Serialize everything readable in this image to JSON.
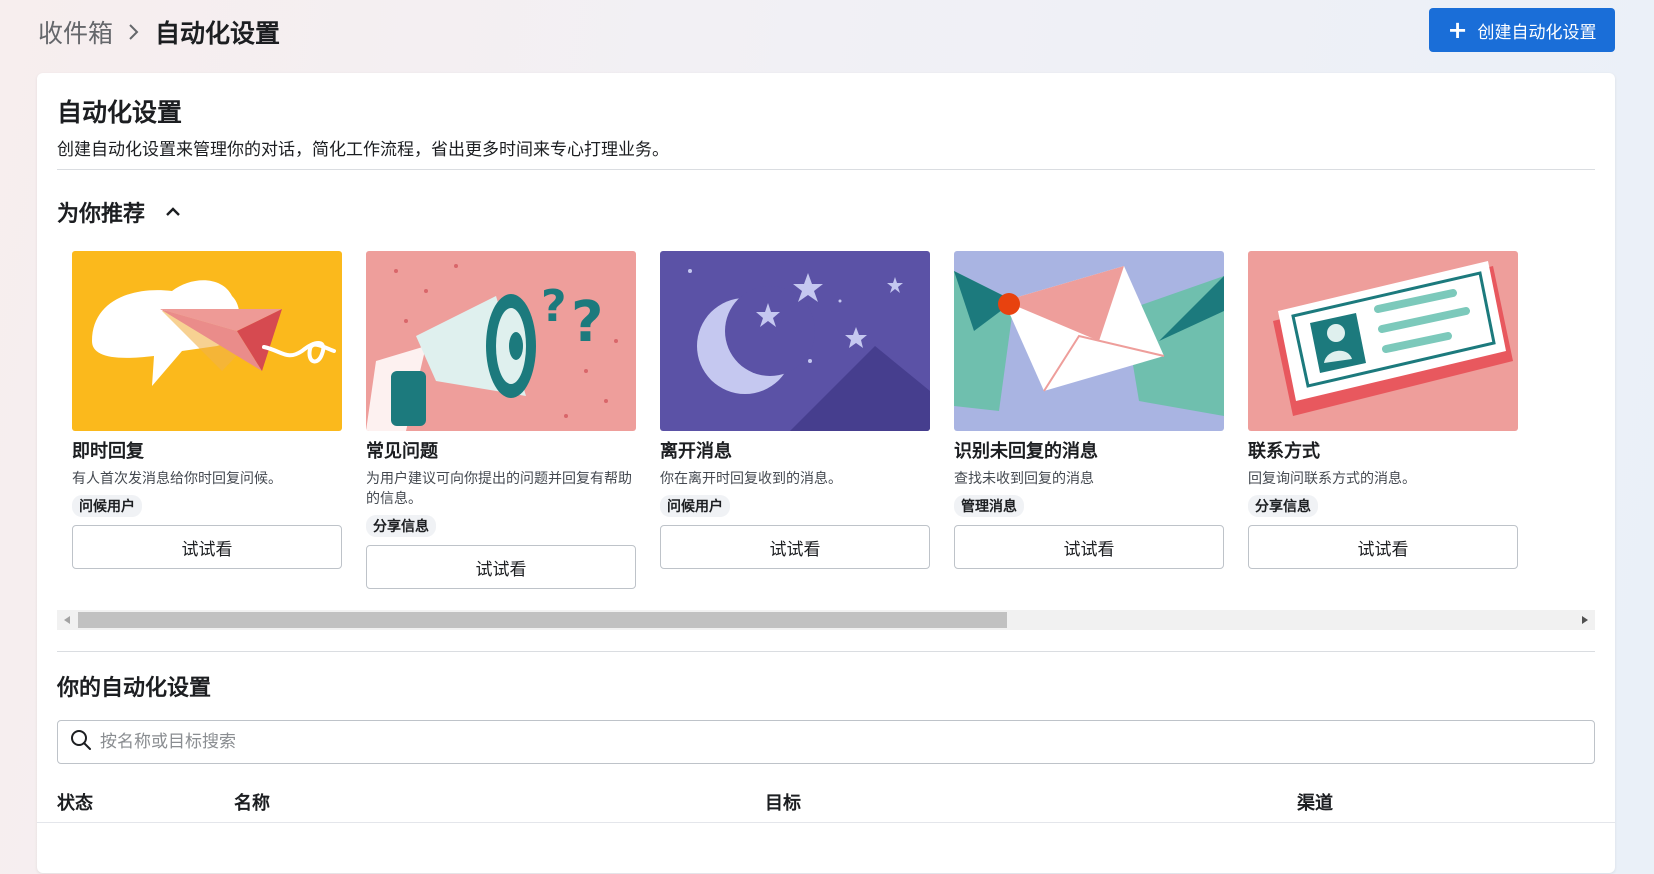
{
  "breadcrumb": {
    "parent": "收件箱",
    "current": "自动化设置"
  },
  "header": {
    "create_label": "创建自动化设置"
  },
  "main": {
    "title": "自动化设置",
    "description": "创建自动化设置来管理你的对话，简化工作流程，省出更多时间来专心打理业务。",
    "recommend_title": "为你推荐",
    "cards": [
      {
        "title": "即时回复",
        "desc": "有人首次发消息给你时回复问候。",
        "tag": "问候用户",
        "button": "试试看"
      },
      {
        "title": "常见问题",
        "desc": "为用户建议可向你提出的问题并回复有帮助的信息。",
        "tag": "分享信息",
        "button": "试试看"
      },
      {
        "title": "离开消息",
        "desc": "你在离开时回复收到的消息。",
        "tag": "问候用户",
        "button": "试试看"
      },
      {
        "title": "识别未回复的消息",
        "desc": "查找未收到回复的消息",
        "tag": "管理消息",
        "button": "试试看"
      },
      {
        "title": "联系方式",
        "desc": "回复询问联系方式的消息。",
        "tag": "分享信息",
        "button": "试试看"
      }
    ],
    "yours_title": "你的自动化设置",
    "search_placeholder": "按名称或目标搜索",
    "table_headers": {
      "status": "状态",
      "name": "名称",
      "target": "目标",
      "channel": "渠道"
    }
  },
  "colors": {
    "accent": "#1a6ed8"
  }
}
